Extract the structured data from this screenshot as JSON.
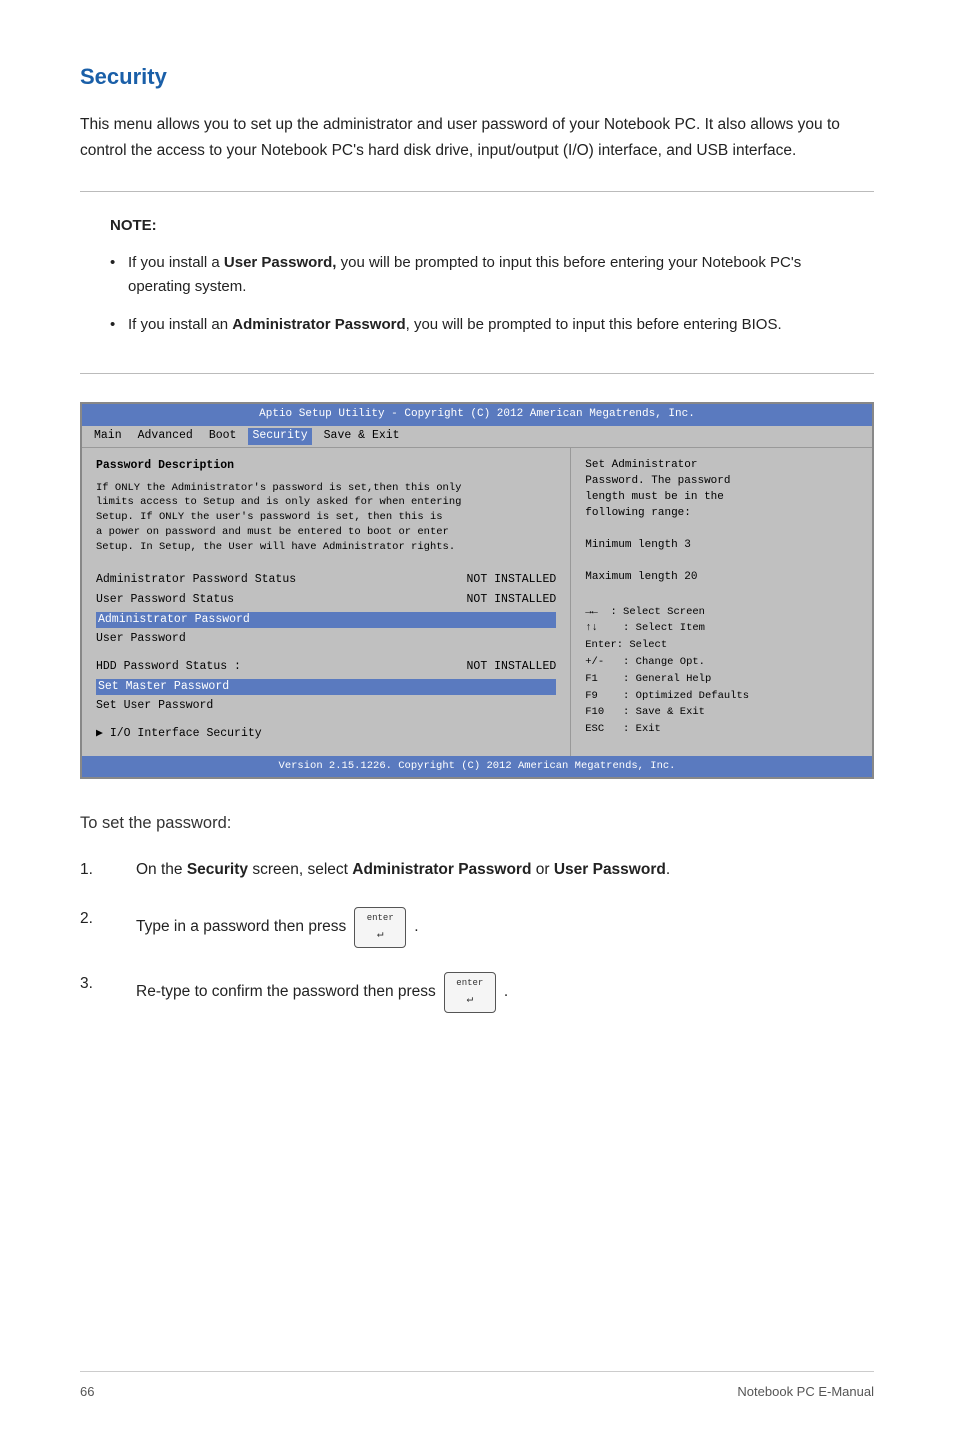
{
  "page": {
    "title": "Security",
    "intro": "This menu allows you to set up the administrator and user password of your Notebook PC. It also allows you to control the access to your Notebook PC's hard disk drive, input/output (I/O) interface, and USB interface.",
    "note": {
      "label": "NOTE:",
      "items": [
        {
          "text_before": "If you install a ",
          "bold": "User Password,",
          "text_after": " you will be prompted to input this before entering your Notebook PC's operating system."
        },
        {
          "text_before": "If you install an ",
          "bold": "Administrator Password",
          "text_after": ", you will be prompted to input this before entering BIOS."
        }
      ]
    },
    "bios": {
      "title_bar": "Aptio Setup Utility - Copyright (C) 2012 American Megatrends, Inc.",
      "menu": [
        "Main",
        "Advanced",
        "Boot",
        "Security",
        "Save & Exit"
      ],
      "active_menu": "Security",
      "left": {
        "section_title": "Password Description",
        "description": "If ONLY the Administrator's password is set,then this only\nlimits access to Setup and is only asked for when entering\nSetup. If ONLY the user's password is set, then this is\na power on password and must be entered to boot or enter\nSetup. In Setup, the User will have Administrator rights.",
        "rows": [
          {
            "label": "Administrator Password Status",
            "value": "NOT INSTALLED",
            "highlighted": false
          },
          {
            "label": "User Password Status",
            "value": "NOT INSTALLED",
            "highlighted": false
          },
          {
            "label": "Administrator Password",
            "value": "",
            "highlighted": true
          },
          {
            "label": "User Password",
            "value": "",
            "highlighted": false
          },
          {
            "label": "HDD Password Status :",
            "value": "NOT INSTALLED",
            "highlighted": false
          },
          {
            "label": "Set Master Password",
            "value": "",
            "highlighted": true
          },
          {
            "label": "Set User Password",
            "value": "",
            "highlighted": false
          }
        ],
        "io_item": "▶ I/O Interface Security"
      },
      "right": {
        "lines": [
          "Set Administrator",
          "Password. The password",
          "length must be in the",
          "following range:",
          "",
          "Minimum length 3",
          "",
          "Maximum length 20"
        ],
        "hints": [
          "→←  : Select Screen",
          "↑↓   : Select Item",
          "Enter: Select",
          "+/-   : Change Opt.",
          "F1    : General Help",
          "F9    : Optimized Defaults",
          "F10   : Save & Exit",
          "ESC   : Exit"
        ]
      },
      "footer": "Version 2.15.1226. Copyright (C) 2012 American Megatrends, Inc."
    },
    "steps_title": "To set the password:",
    "steps": [
      {
        "num": "1.",
        "text_before": "On the ",
        "bold1": "Security",
        "text_mid": " screen, select ",
        "bold2": "Administrator Password",
        "text_mid2": " or ",
        "bold3": "User Password",
        "text_after": "."
      },
      {
        "num": "2.",
        "text_before": "Type in a password then press",
        "key_label": "enter",
        "text_after": "."
      },
      {
        "num": "3.",
        "text_before": "Re-type to confirm the password then press",
        "key_label": "enter",
        "text_after": "."
      }
    ],
    "footer": {
      "page_num": "66",
      "title": "Notebook PC E-Manual"
    }
  }
}
